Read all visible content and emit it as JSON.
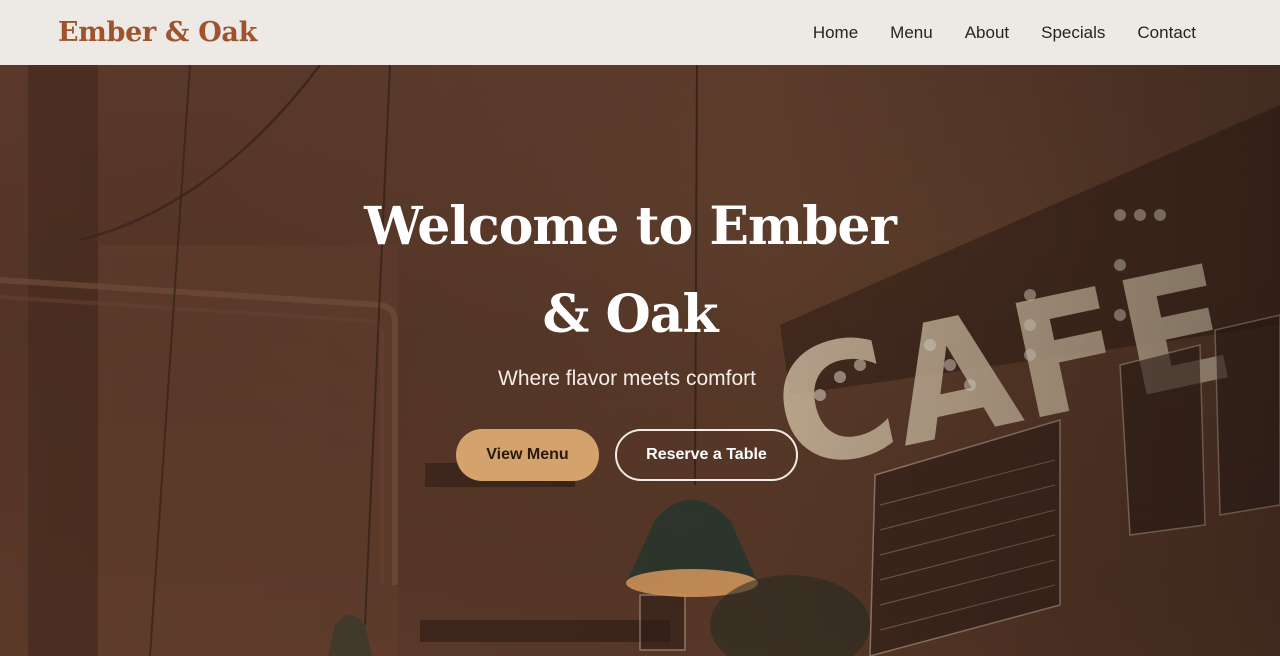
{
  "brand": {
    "name": "Ember & Oak",
    "color": "#a0522d"
  },
  "nav": {
    "items": [
      {
        "label": "Home"
      },
      {
        "label": "Menu"
      },
      {
        "label": "About"
      },
      {
        "label": "Specials"
      },
      {
        "label": "Contact"
      }
    ]
  },
  "hero": {
    "title": "Welcome to Ember & Oak",
    "subtitle": "Where flavor meets comfort",
    "primary_button": "View Menu",
    "secondary_button": "Reserve a Table",
    "accent_color": "#d4a26c"
  }
}
